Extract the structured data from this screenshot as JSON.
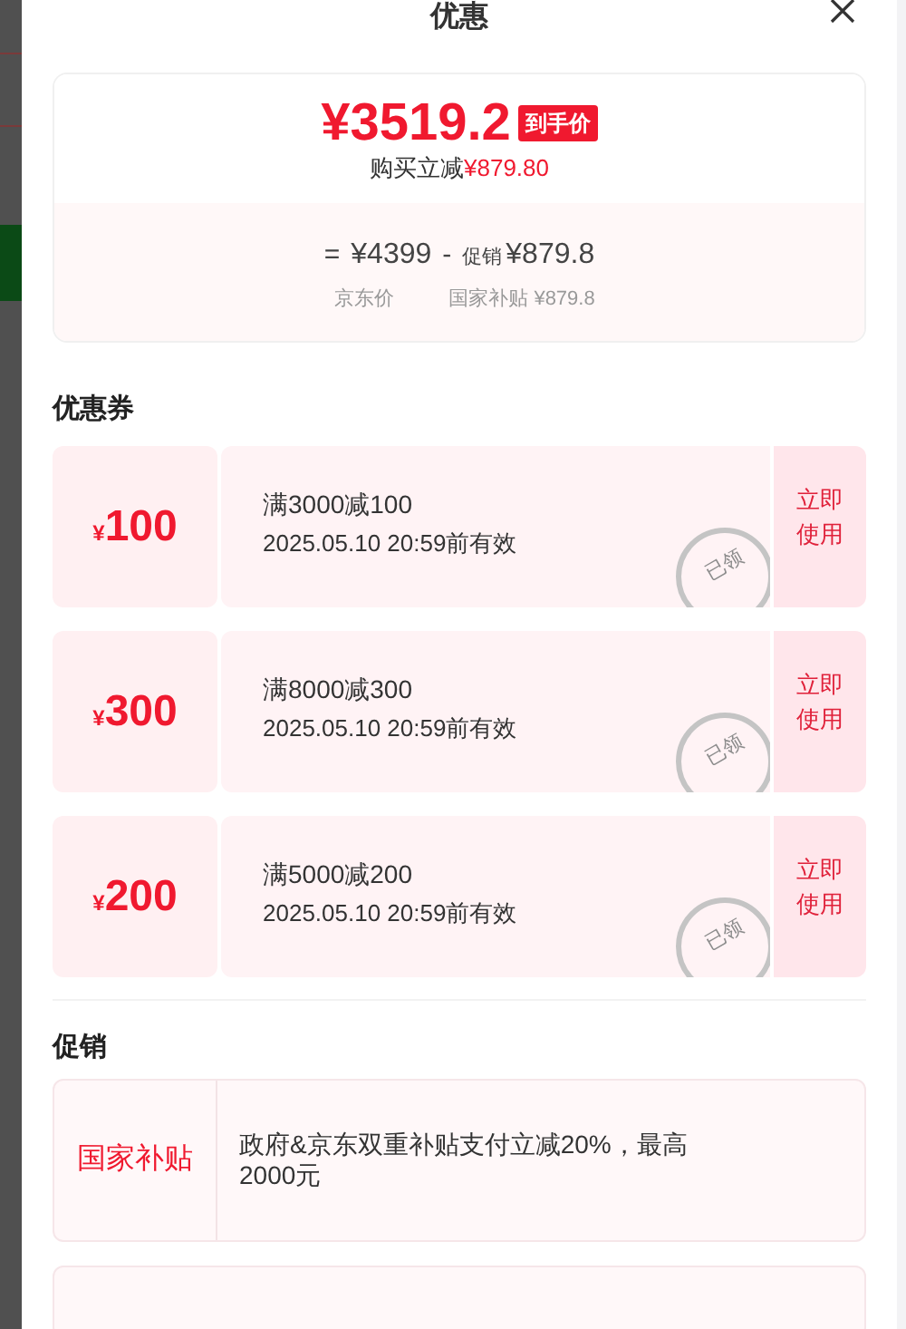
{
  "sheet": {
    "title": "优惠"
  },
  "price_card": {
    "final_price": "¥3519.2",
    "badge": "到手价",
    "reduction_label": "购买立减",
    "reduction_amount": "¥879.80",
    "formula": [
      {
        "kind": "symbol",
        "text": "="
      },
      {
        "kind": "amount",
        "text": "¥4399"
      },
      {
        "kind": "symbol",
        "text": "-"
      },
      {
        "kind": "tag",
        "text": "促销"
      },
      {
        "kind": "amount",
        "text": "¥879.8"
      }
    ],
    "captions": [
      "京东价",
      "国家补贴 ¥879.8"
    ]
  },
  "coupons_section": {
    "title": "优惠券",
    "coupons": [
      {
        "currency": "¥",
        "amount": "100",
        "condition": "满3000减100",
        "validity": "2025.05.10 20:59前有效",
        "claimed": true,
        "stamp": "已领",
        "action": "立即使用"
      },
      {
        "currency": "¥",
        "amount": "300",
        "condition": "满8000减300",
        "validity": "2025.05.10 20:59前有效",
        "claimed": true,
        "stamp": "已领",
        "action": "立即使用"
      },
      {
        "currency": "¥",
        "amount": "200",
        "condition": "满5000减200",
        "validity": "2025.05.10 20:59前有效",
        "claimed": true,
        "stamp": "已领",
        "action": "立即使用"
      }
    ]
  },
  "promotions_section": {
    "title": "促销",
    "promotions": [
      {
        "tag": "国家补贴",
        "description": "政府&京东双重补贴支付立减20%，最高2000元"
      }
    ]
  }
}
